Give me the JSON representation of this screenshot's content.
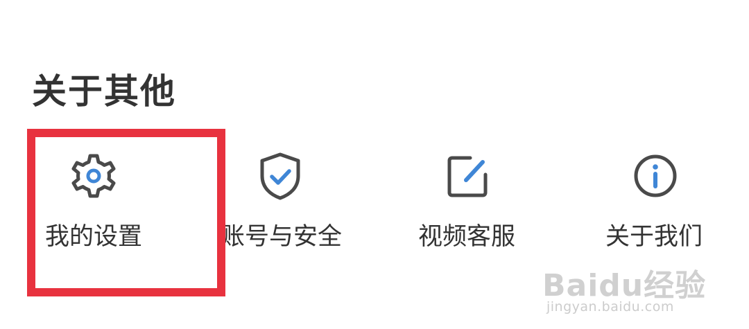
{
  "section": {
    "title": "关于其他"
  },
  "items": [
    {
      "id": "settings",
      "label": "我的设置",
      "icon": "gear-icon"
    },
    {
      "id": "account",
      "label": "账号与安全",
      "icon": "shield-check-icon"
    },
    {
      "id": "video",
      "label": "视频客服",
      "icon": "edit-square-icon"
    },
    {
      "id": "about",
      "label": "关于我们",
      "icon": "info-circle-icon"
    }
  ],
  "watermark": {
    "brand": "Baidu经验",
    "url": "jingyan.baidu.com"
  },
  "colors": {
    "text": "#333333",
    "icon_outline": "#4a4a4a",
    "icon_accent": "#3f86d6",
    "highlight": "#e8323f",
    "watermark": "#d0d0d0"
  }
}
